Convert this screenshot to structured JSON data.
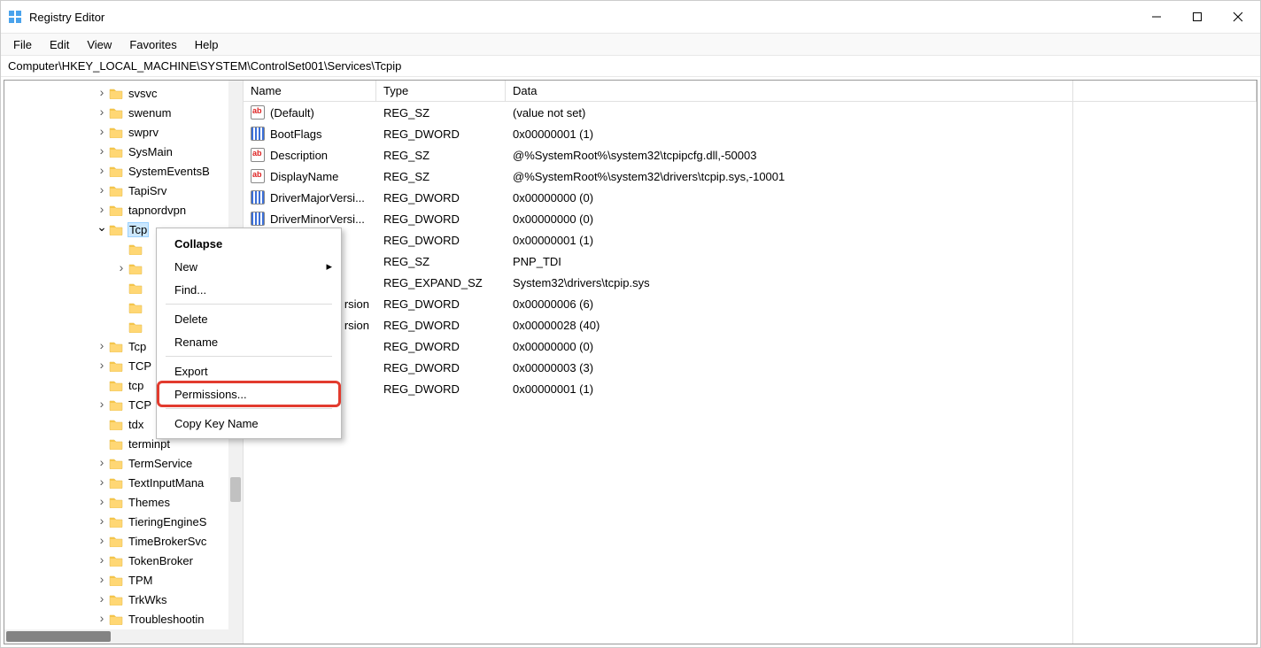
{
  "window": {
    "title": "Registry Editor"
  },
  "menubar": [
    "File",
    "Edit",
    "View",
    "Favorites",
    "Help"
  ],
  "address": "Computer\\HKEY_LOCAL_MACHINE\\SYSTEM\\ControlSet001\\Services\\Tcpip",
  "tree": [
    {
      "label": "svsvc",
      "chev": "right",
      "indent": "ind-0"
    },
    {
      "label": "swenum",
      "chev": "right",
      "indent": "ind-0"
    },
    {
      "label": "swprv",
      "chev": "right",
      "indent": "ind-0"
    },
    {
      "label": "SysMain",
      "chev": "right",
      "indent": "ind-0"
    },
    {
      "label": "SystemEventsB",
      "chev": "right",
      "indent": "ind-0"
    },
    {
      "label": "TapiSrv",
      "chev": "right",
      "indent": "ind-0"
    },
    {
      "label": "tapnordvpn",
      "chev": "right",
      "indent": "ind-0"
    },
    {
      "label": "Tcp",
      "chev": "down",
      "indent": "ind-0",
      "selected": true
    },
    {
      "label": "",
      "chev": "",
      "indent": "ind-1nc",
      "bare": true
    },
    {
      "label": "",
      "chev": "right",
      "indent": "ind-1",
      "bare": true
    },
    {
      "label": "",
      "chev": "",
      "indent": "ind-1nc",
      "bare": true
    },
    {
      "label": "",
      "chev": "",
      "indent": "ind-1nc",
      "bare": true
    },
    {
      "label": "",
      "chev": "",
      "indent": "ind-1nc",
      "bare": true
    },
    {
      "label": "Tcp",
      "chev": "right",
      "indent": "ind-0"
    },
    {
      "label": "TCP",
      "chev": "right",
      "indent": "ind-0"
    },
    {
      "label": "tcp",
      "chev": "",
      "indent": "ind-0nc"
    },
    {
      "label": "TCP",
      "chev": "right",
      "indent": "ind-0"
    },
    {
      "label": "tdx",
      "chev": "",
      "indent": "ind-0nc"
    },
    {
      "label": "terminpt",
      "chev": "",
      "indent": "ind-0nc"
    },
    {
      "label": "TermService",
      "chev": "right",
      "indent": "ind-0"
    },
    {
      "label": "TextInputMana",
      "chev": "right",
      "indent": "ind-0"
    },
    {
      "label": "Themes",
      "chev": "right",
      "indent": "ind-0"
    },
    {
      "label": "TieringEngineS",
      "chev": "right",
      "indent": "ind-0"
    },
    {
      "label": "TimeBrokerSvc",
      "chev": "right",
      "indent": "ind-0"
    },
    {
      "label": "TokenBroker",
      "chev": "right",
      "indent": "ind-0"
    },
    {
      "label": "TPM",
      "chev": "right",
      "indent": "ind-0"
    },
    {
      "label": "TrkWks",
      "chev": "right",
      "indent": "ind-0"
    },
    {
      "label": "Troubleshootin",
      "chev": "right",
      "indent": "ind-0"
    }
  ],
  "columns": {
    "name": "Name",
    "type": "Type",
    "data": "Data"
  },
  "values": [
    {
      "icon": "sz",
      "name": "(Default)",
      "type": "REG_SZ",
      "data": "(value not set)"
    },
    {
      "icon": "dw",
      "name": "BootFlags",
      "type": "REG_DWORD",
      "data": "0x00000001 (1)"
    },
    {
      "icon": "sz",
      "name": "Description",
      "type": "REG_SZ",
      "data": "@%SystemRoot%\\system32\\tcpipcfg.dll,-50003"
    },
    {
      "icon": "sz",
      "name": "DisplayName",
      "type": "REG_SZ",
      "data": "@%SystemRoot%\\system32\\drivers\\tcpip.sys,-10001"
    },
    {
      "icon": "dw",
      "name": "DriverMajorVersi...",
      "type": "REG_DWORD",
      "data": "0x00000000 (0)"
    },
    {
      "icon": "dw",
      "name": "DriverMinorVersi...",
      "type": "REG_DWORD",
      "data": "0x00000000 (0)"
    },
    {
      "icon": "",
      "name": "",
      "type": "REG_DWORD",
      "data": "0x00000001 (1)"
    },
    {
      "icon": "",
      "name": "",
      "type": "REG_SZ",
      "data": "PNP_TDI"
    },
    {
      "icon": "",
      "name": "",
      "type": "REG_EXPAND_SZ",
      "data": "System32\\drivers\\tcpip.sys"
    },
    {
      "icon": "",
      "name": "rsion",
      "type": "REG_DWORD",
      "data": "0x00000006 (6)"
    },
    {
      "icon": "",
      "name": "rsion",
      "type": "REG_DWORD",
      "data": "0x00000028 (40)"
    },
    {
      "icon": "",
      "name": "",
      "type": "REG_DWORD",
      "data": "0x00000000 (0)"
    },
    {
      "icon": "",
      "name": "",
      "type": "REG_DWORD",
      "data": "0x00000003 (3)"
    },
    {
      "icon": "",
      "name": "",
      "type": "REG_DWORD",
      "data": "0x00000001 (1)"
    }
  ],
  "context_menu": {
    "items": [
      {
        "label": "Collapse",
        "bold": true
      },
      {
        "label": "New",
        "submenu": true
      },
      {
        "label": "Find..."
      },
      {
        "sep": true
      },
      {
        "label": "Delete"
      },
      {
        "label": "Rename"
      },
      {
        "sep": true
      },
      {
        "label": "Export"
      },
      {
        "label": "Permissions...",
        "highlight": true
      },
      {
        "sep": true
      },
      {
        "label": "Copy Key Name"
      }
    ]
  }
}
